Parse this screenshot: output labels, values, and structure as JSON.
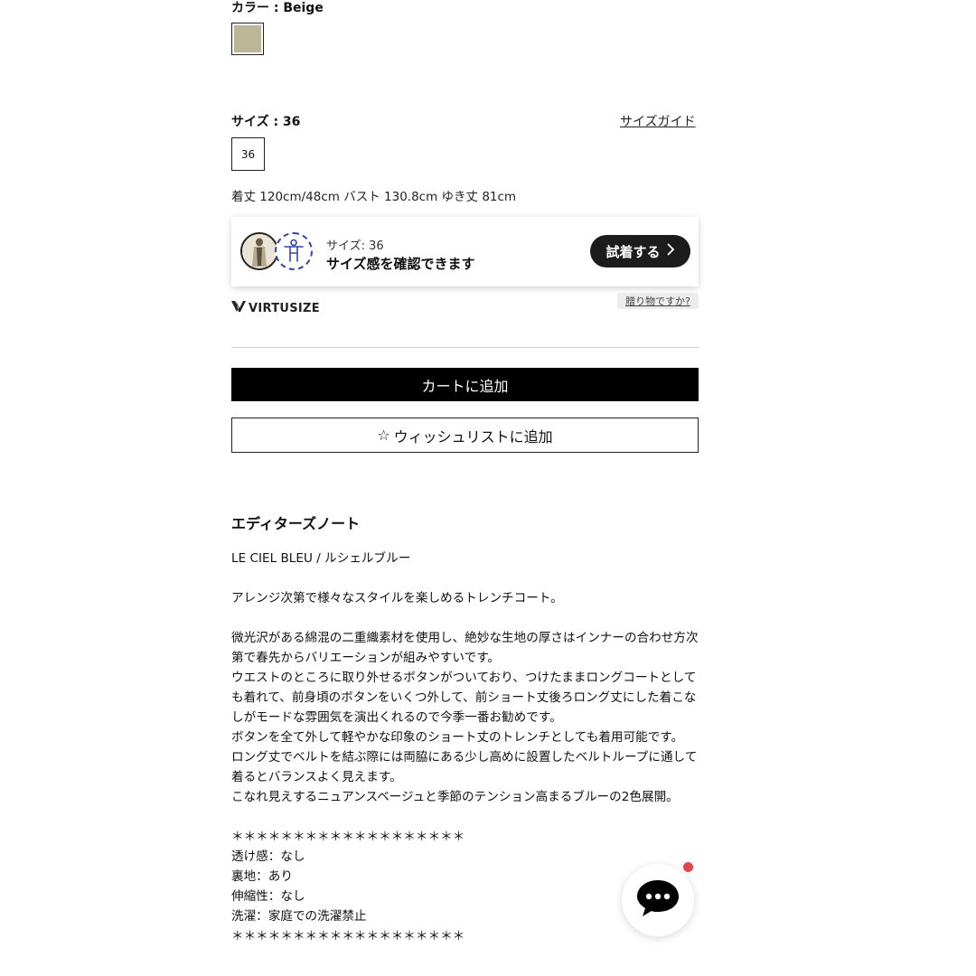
{
  "color": {
    "label": "カラー : Beige",
    "swatch_color": "#bcb597"
  },
  "size": {
    "label": "サイズ : 36",
    "guide_link": "サイズガイド",
    "options": [
      "36"
    ],
    "measurements": "着丈 120cm/48cm バスト 130.8cm ゆき丈 81cm"
  },
  "virtusize": {
    "size_text": "サイズ: 36",
    "message": "サイズ感を確認できます",
    "try_button": "試着する",
    "logo": "VIRTUSIZE",
    "gift_link": "贈り物ですか?"
  },
  "actions": {
    "cart_button": "カートに追加",
    "wishlist_star": "☆",
    "wishlist_button": "ウィッシュリストに追加"
  },
  "editor": {
    "title": "エディターズノート",
    "brand": "LE CIEL BLEU / ルシェルブルー",
    "lead": "アレンジ次第で様々なスタイルを楽しめるトレンチコート。",
    "p1": "微光沢がある綿混の二重織素材を使用し、絶妙な生地の厚さはインナーの合わせ方次第で春先からバリエーションが組みやすいです。",
    "p2": "ウエストのところに取り外せるボタンがついており、つけたままロングコートとしても着れて、前身頃のボタンをいくつ外して、前ショート丈後ろロング丈にした着こなしがモードな雰囲気を演出くれるので今季一番お勧めです。",
    "p3": "ボタンを全て外して軽やかな印象のショート丈のトレンチとしても着用可能です。",
    "p4": "ロング丈でベルトを結ぶ際には両脇にある少し高めに設置したベルトループに通して着るとバランスよく見えます。",
    "p5": "こなれ見えするニュアンスベージュと季節のテンション高まるブルーの2色展開。",
    "stars": "＊＊＊＊＊＊＊＊＊＊＊＊＊＊＊＊＊＊＊",
    "spec1": "透け感：なし",
    "spec2": "裏地：あり",
    "spec3": "伸縮性：なし",
    "spec4": "洗濯：家庭での洗濯禁止",
    "stars2": "＊＊＊＊＊＊＊＊＊＊＊＊＊＊＊＊＊＊＊"
  },
  "icons": {
    "chat": "chat-bubble-icon",
    "body": "body-measure-icon",
    "chevron": "chevron-right-icon",
    "logo": "virtusize-logo-icon"
  },
  "colors": {
    "accent": "#000000",
    "notify": "#e0464c",
    "virtusize_blue": "#3346a8"
  }
}
